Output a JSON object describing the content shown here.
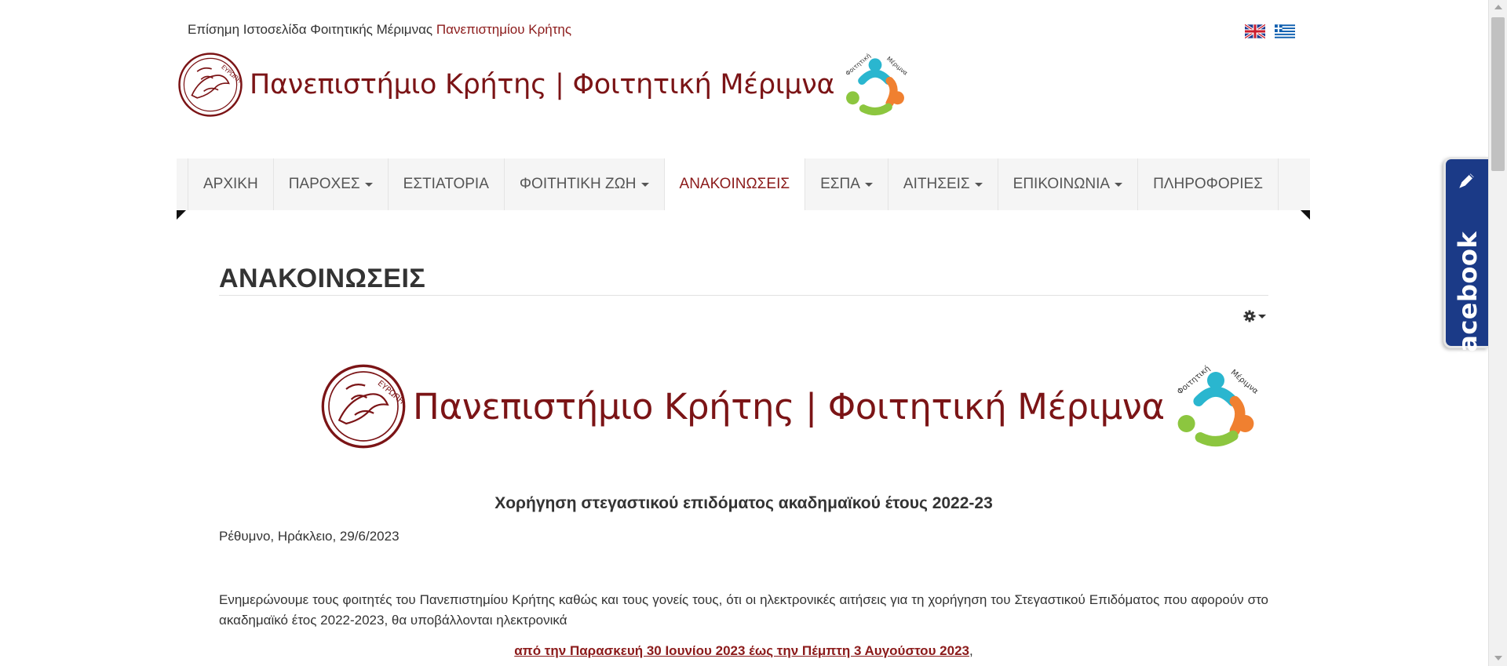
{
  "top_bar": {
    "tagline_prefix": "Επίσημη Ιστοσελίδα Φοιτητικής Μέριμνας",
    "tagline_link": "Πανεπιστημίου Κρήτης",
    "languages": [
      "English",
      "Ελληνικά"
    ]
  },
  "header": {
    "logo_text": "Πανεπιστήμιο Κρήτης | Φοιτητική Μέριμνα",
    "seal_text": "ΕΥΡΩΠΗ",
    "badge_text_1": "Φοιτητική",
    "badge_text_2": "Μέριμνα"
  },
  "nav": {
    "items": [
      {
        "label": "ΑΡΧΙΚΗ",
        "dropdown": false
      },
      {
        "label": "ΠΑΡΟΧΕΣ",
        "dropdown": true
      },
      {
        "label": "ΕΣΤΙΑΤΟΡΙΑ",
        "dropdown": false
      },
      {
        "label": "ΦΟΙΤΗΤΙΚΗ ΖΩΗ",
        "dropdown": true
      },
      {
        "label": "ΑΝΑΚΟΙΝΩΣΕΙΣ",
        "dropdown": false
      },
      {
        "label": "ΕΣΠΑ",
        "dropdown": true
      },
      {
        "label": "ΑΙΤΗΣΕΙΣ",
        "dropdown": true
      },
      {
        "label": "ΕΠΙΚΟΙΝΩΝΙΑ",
        "dropdown": true
      },
      {
        "label": "ΠΛΗΡΟΦΟΡΙΕΣ",
        "dropdown": false
      }
    ],
    "active": "ΑΝΑΚΟΙΝΩΣΕΙΣ"
  },
  "page": {
    "title": "ΑΝΑΚΟΙΝΩΣΕΙΣ",
    "tools_icon": "gear-icon"
  },
  "article": {
    "title": "Χορήγηση στεγαστικού επιδόματος ακαδημαϊκού έτους 2022-23",
    "dateline": "Ρέθυμνο, Ηράκλειο, 29/6/2023",
    "paragraph": "Ενημερώνουμε τους φοιτητές του Πανεπιστημίου Κρήτης καθώς και τους γονείς τους, ότι οι ηλεκτρονικές αιτήσεις για τη χορήγηση του Στεγαστικού Επιδόματος που αφορούν στο ακαδημαϊκό έτος 2022-2023, θα υποβάλλονται ηλεκτρονικά",
    "date_range": "από την  Παρασκευή 30 Ιουνίου 2023 έως την  Πέμπτη 3 Αυγούστου 2023",
    "date_range_suffix": ","
  },
  "facebook": {
    "label": "facebook",
    "icon": "pen-icon"
  },
  "colors": {
    "brand": "#7b1416",
    "accent": "#8b1a1a",
    "facebook_blue": "#1b3a87",
    "nav_bg": "#f5f5f5",
    "logo_cyan": "#2ab6cf",
    "logo_orange": "#f08030",
    "logo_green": "#8cc63f"
  }
}
